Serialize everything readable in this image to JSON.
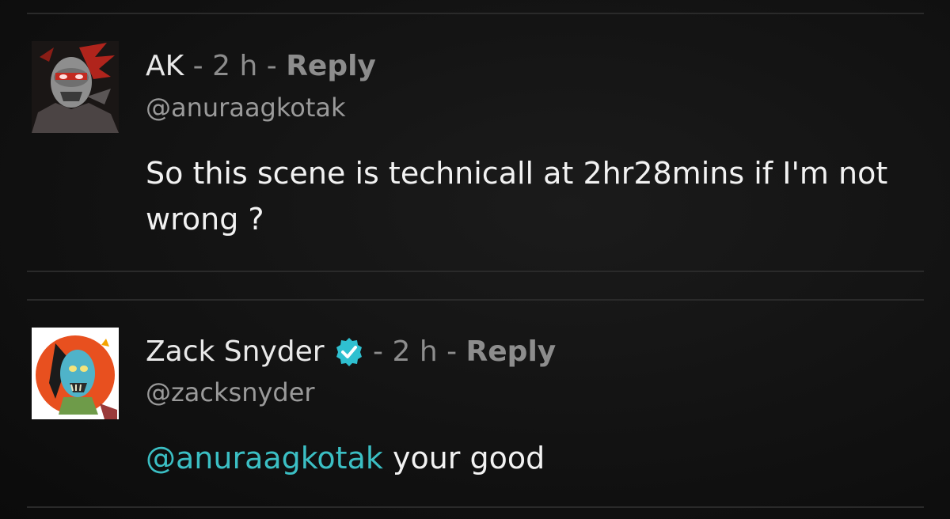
{
  "comments": [
    {
      "author": "AK",
      "verified": false,
      "separator": " - ",
      "time": "2 h",
      "reply_label": "Reply",
      "handle": "@anuraagkotak",
      "text": "So this scene is technicall at 2hr28mins if I'm not wrong ?",
      "avatar_icon": "dark-villain-avatar"
    },
    {
      "author": "Zack Snyder",
      "verified": true,
      "separator": " - ",
      "time": "2 h",
      "reply_label": "Reply",
      "handle": "@zacksnyder",
      "mention": "@anuraagkotak",
      "text": " your good",
      "avatar_icon": "zombie-hero-avatar",
      "verified_icon": "verified-badge-icon",
      "accent_color": "#3bbfc4"
    }
  ]
}
